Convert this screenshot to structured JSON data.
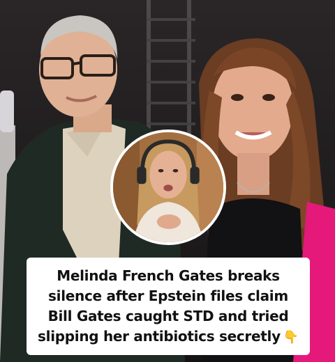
{
  "caption": {
    "lines": [
      "Melinda French Gates breaks",
      "silence after Epstein files claim",
      "Bill Gates caught STD and tried",
      "slipping her antibiotics secretly"
    ],
    "emoji": "👇"
  },
  "icons": {
    "pointer": "pointing-down-hand-icon"
  },
  "colors": {
    "caption_background": "#ffffff",
    "caption_text": "#111111",
    "inset_border": "#ffffff",
    "pink_jacket": "#e5197a"
  }
}
